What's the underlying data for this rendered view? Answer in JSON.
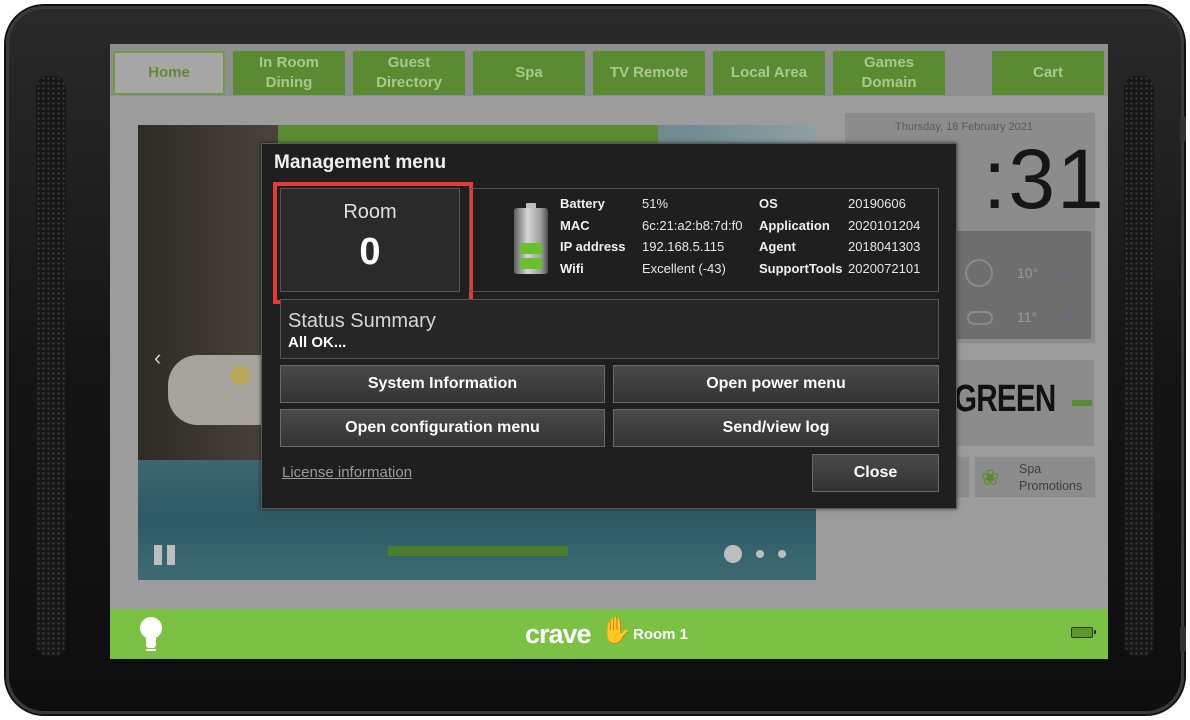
{
  "nav": {
    "tabs": [
      {
        "label": "Home",
        "active": true
      },
      {
        "label": "In Room Dining",
        "line1": "In Room",
        "line2": "Dining"
      },
      {
        "label": "Guest Directory",
        "line1": "Guest",
        "line2": "Directory"
      },
      {
        "label": "Spa"
      },
      {
        "label": "TV Remote"
      },
      {
        "label": "Local Area"
      },
      {
        "label": "Games Domain",
        "line1": "Games",
        "line2": "Domain"
      },
      {
        "label": "Cart"
      }
    ]
  },
  "widgets": {
    "date": "Thursday, 18 February 2021",
    "clock": ":31",
    "weather": [
      {
        "temp": "10°",
        "icon": "sun-icon"
      },
      {
        "temp": "11°",
        "icon": "cloud-rain-icon"
      }
    ],
    "brand": "GREEN",
    "promo": {
      "line1": "Spa",
      "line2": "Promotions"
    }
  },
  "modal": {
    "title": "Management menu",
    "room_label": "Room",
    "room_value": "0",
    "info": {
      "battery_label": "Battery",
      "battery_value": "51%",
      "mac_label": "MAC",
      "mac_value": "6c:21:a2:b8:7d:f0",
      "ip_label": "IP address",
      "ip_value": "192.168.5.115",
      "wifi_label": "Wifi",
      "wifi_value": "Excellent (-43)",
      "os_label": "OS",
      "os_value": "20190606",
      "app_label": "Application",
      "app_value": "2020101204",
      "agent_label": "Agent",
      "agent_value": "2018041303",
      "support_label": "SupportTools",
      "support_value": "2020072101"
    },
    "status_title": "Status Summary",
    "status_value": "All OK...",
    "buttons": {
      "system_info": "System Information",
      "power_menu": "Open power menu",
      "config_menu": "Open configuration menu",
      "send_log": "Send/view log",
      "close": "Close"
    },
    "license_link": "License information",
    "battery_level": 0.51
  },
  "footer": {
    "logo": "crave",
    "room": "Room 1"
  },
  "colors": {
    "accent_green": "#7bc144",
    "highlight_red": "#e43a3a",
    "modal_bg": "#1f1f1f"
  }
}
